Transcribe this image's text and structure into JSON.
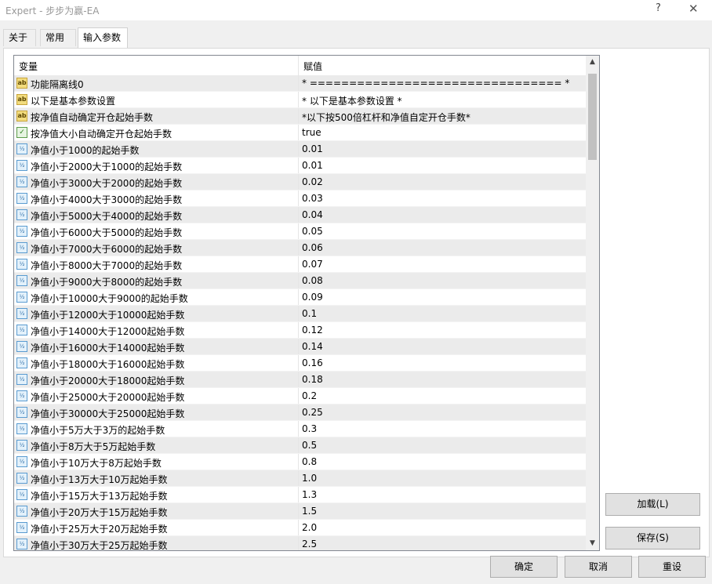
{
  "window": {
    "title": "Expert - 步步为赢-EA",
    "help_glyph": "?",
    "close_glyph": "✕"
  },
  "tabs": [
    {
      "label": "关于",
      "active": false
    },
    {
      "label": "常用",
      "active": false
    },
    {
      "label": "输入参数",
      "active": true
    }
  ],
  "grid": {
    "columns": [
      "变量",
      "赋值"
    ],
    "rows": [
      {
        "icon": "ab",
        "name": "功能隔离线0",
        "value": "* ================================ *"
      },
      {
        "icon": "ab",
        "name": "以下是基本参数设置",
        "value": "* 以下是基本参数设置 *"
      },
      {
        "icon": "ab",
        "name": "按净值自动确定开仓起始手数",
        "value": "*以下按500倍杠杆和净值自定开仓手数*"
      },
      {
        "icon": "bool",
        "name": "按净值大小自动确定开仓起始手数",
        "value": "true"
      },
      {
        "icon": "num",
        "name": "净值小于1000的起始手数",
        "value": "0.01"
      },
      {
        "icon": "num",
        "name": "净值小于2000大于1000的起始手数",
        "value": "0.01"
      },
      {
        "icon": "num",
        "name": "净值小于3000大于2000的起始手数",
        "value": "0.02"
      },
      {
        "icon": "num",
        "name": "净值小于4000大于3000的起始手数",
        "value": "0.03"
      },
      {
        "icon": "num",
        "name": "净值小于5000大于4000的起始手数",
        "value": "0.04"
      },
      {
        "icon": "num",
        "name": "净值小于6000大于5000的起始手数",
        "value": "0.05"
      },
      {
        "icon": "num",
        "name": "净值小于7000大于6000的起始手数",
        "value": "0.06"
      },
      {
        "icon": "num",
        "name": "净值小于8000大于7000的起始手数",
        "value": "0.07"
      },
      {
        "icon": "num",
        "name": "净值小于9000大于8000的起始手数",
        "value": "0.08"
      },
      {
        "icon": "num",
        "name": "净值小于10000大于9000的起始手数",
        "value": "0.09"
      },
      {
        "icon": "num",
        "name": "净值小于12000大于10000起始手数",
        "value": "0.1"
      },
      {
        "icon": "num",
        "name": "净值小于14000大于12000起始手数",
        "value": "0.12"
      },
      {
        "icon": "num",
        "name": "净值小于16000大于14000起始手数",
        "value": "0.14"
      },
      {
        "icon": "num",
        "name": "净值小于18000大于16000起始手数",
        "value": "0.16"
      },
      {
        "icon": "num",
        "name": "净值小于20000大于18000起始手数",
        "value": "0.18"
      },
      {
        "icon": "num",
        "name": "净值小于25000大于20000起始手数",
        "value": "0.2"
      },
      {
        "icon": "num",
        "name": "净值小于30000大于25000起始手数",
        "value": "0.25"
      },
      {
        "icon": "num",
        "name": "净值小于5万大于3万的起始手数",
        "value": "0.3"
      },
      {
        "icon": "num",
        "name": "净值小于8万大于5万起始手数",
        "value": "0.5"
      },
      {
        "icon": "num",
        "name": "净值小于10万大于8万起始手数",
        "value": "0.8"
      },
      {
        "icon": "num",
        "name": "净值小于13万大于10万起始手数",
        "value": "1.0"
      },
      {
        "icon": "num",
        "name": "净值小于15万大于13万起始手数",
        "value": "1.3"
      },
      {
        "icon": "num",
        "name": "净值小于20万大于15万起始手数",
        "value": "1.5"
      },
      {
        "icon": "num",
        "name": "净值小于25万大于20万起始手数",
        "value": "2.0"
      },
      {
        "icon": "num",
        "name": "净值小于30万大于25万起始手数",
        "value": "2.5"
      }
    ]
  },
  "icon_glyphs": {
    "ab": "ab",
    "bool": "✓",
    "num": "½"
  },
  "buttons": {
    "load": "加载(L)",
    "save": "保存(S)",
    "ok": "确定",
    "cancel": "取消",
    "reset": "重设"
  }
}
